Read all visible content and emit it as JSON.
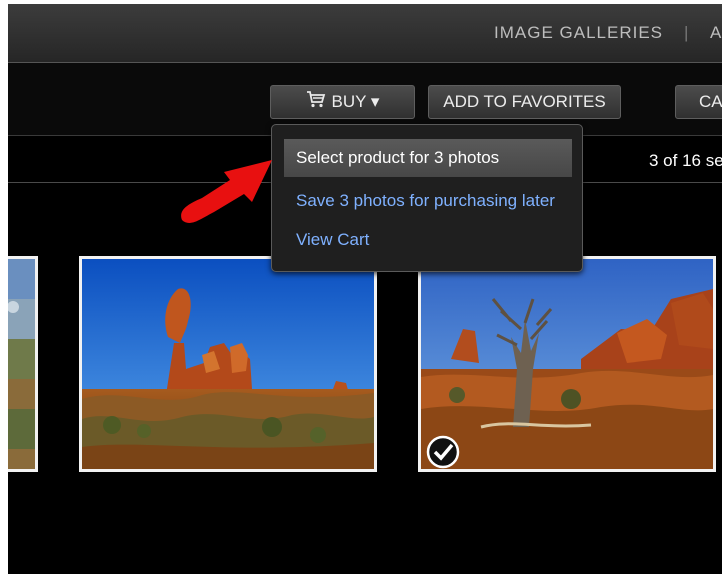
{
  "nav": {
    "items": [
      "IMAGE GALLERIES",
      "|",
      "A"
    ]
  },
  "toolbar": {
    "buy_label": "BUY ▾",
    "favorites_label": "ADD TO FAVORITES",
    "cart_label": "CA"
  },
  "status": {
    "count_text": "3 of 16 se"
  },
  "dropdown": {
    "items": [
      "Select product for 3 photos",
      "Save 3 photos for purchasing later",
      "View Cart"
    ]
  },
  "photos": [
    {
      "subject": "partial-landscape",
      "selected": false
    },
    {
      "subject": "balanced-rock",
      "selected": false
    },
    {
      "subject": "juniper-tree-arches",
      "selected": true
    }
  ],
  "colors": {
    "link": "#7fb1ff",
    "highlight": "#5a5a5a",
    "arrow": "#e81010"
  }
}
